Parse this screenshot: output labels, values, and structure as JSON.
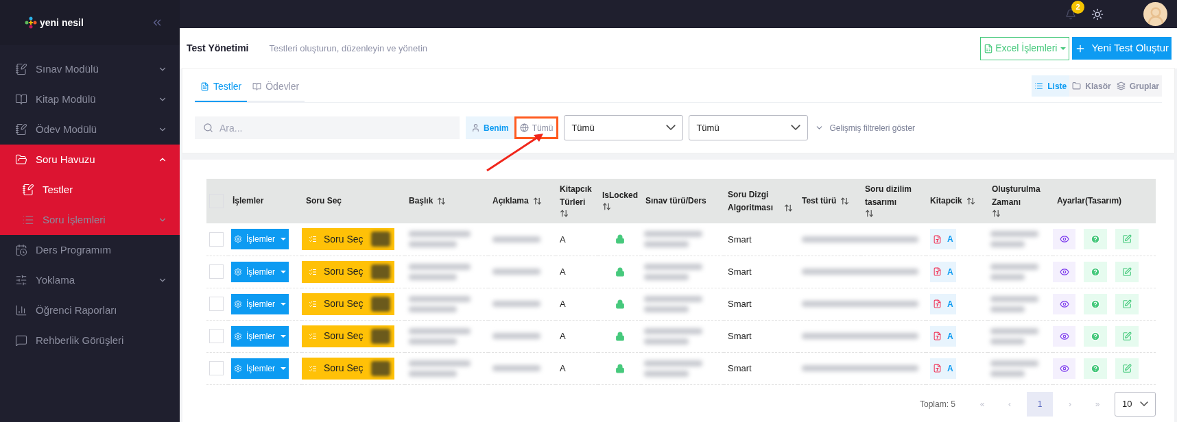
{
  "sidebar": {
    "logo": "yeni nesil",
    "items": [
      {
        "label": "Sınav Modülü",
        "expanded": false,
        "selected": false
      },
      {
        "label": "Kitap Modülü",
        "expanded": false,
        "selected": false
      },
      {
        "label": "Ödev Modülü",
        "expanded": false,
        "selected": false
      },
      {
        "label": "Soru Havuzu",
        "expanded": true,
        "selected": true,
        "children": [
          {
            "label": "Testler",
            "selected": true
          },
          {
            "label": "Soru İşlemleri",
            "expanded": false,
            "selected": false
          }
        ]
      },
      {
        "label": "Ders Programım",
        "selected": false
      },
      {
        "label": "Yoklama",
        "expanded": false,
        "selected": false
      },
      {
        "label": "Öğrenci Raporları",
        "selected": false
      },
      {
        "label": "Rehberlik Görüşleri",
        "selected": false
      }
    ]
  },
  "topbar": {
    "notification_count": "2"
  },
  "header": {
    "title": "Test Yönetimi",
    "subtitle": "Testleri oluşturun, düzenleyin ve yönetin",
    "excel_button": "Excel İşlemleri",
    "create_button": "Yeni Test Oluştur"
  },
  "tabs": [
    {
      "label": "Testler",
      "selected": true
    },
    {
      "label": "Ödevler",
      "selected": false
    }
  ],
  "view_modes": [
    {
      "label": "Liste",
      "selected": true
    },
    {
      "label": "Klasör",
      "selected": false
    },
    {
      "label": "Gruplar",
      "selected": false
    }
  ],
  "filters": {
    "search_placeholder": "Ara...",
    "scope": [
      {
        "label": "Benim",
        "selected": true,
        "highlighted": false
      },
      {
        "label": "Tümü",
        "selected": false,
        "highlighted": true
      }
    ],
    "selects": [
      "Tümü",
      "Tümü"
    ],
    "advanced_link": "Gelişmiş filtreleri göster"
  },
  "table": {
    "all_checked": false,
    "columns": [
      {
        "label": "İşlemler",
        "sortable": false
      },
      {
        "label": "Soru Seç",
        "sortable": false
      },
      {
        "label": "Başlık",
        "sortable": true
      },
      {
        "label": "Açıklama",
        "sortable": true
      },
      {
        "label": "Kitapcık Türleri",
        "sortable": true
      },
      {
        "label": "IsLocked",
        "sortable": true
      },
      {
        "label": "Sınav türü/Ders",
        "sortable": false
      },
      {
        "label": "Soru Dizgi Algoritması",
        "sortable": true
      },
      {
        "label": "Test türü",
        "sortable": true
      },
      {
        "label": "Soru dizilim tasarımı",
        "sortable": true
      },
      {
        "label": "Kitapcik",
        "sortable": true
      },
      {
        "label": "Oluşturulma Zamanı",
        "sortable": true
      },
      {
        "label": "Ayarlar(Tasarım)",
        "sortable": false
      }
    ],
    "rows": [
      {
        "checked": false,
        "actions": "İşlemler",
        "select": "Soru Seç",
        "booklet_types": "A",
        "locked": true,
        "algorithm": "Smart",
        "booklet": "A"
      },
      {
        "checked": false,
        "actions": "İşlemler",
        "select": "Soru Seç",
        "booklet_types": "A",
        "locked": true,
        "algorithm": "Smart",
        "booklet": "A"
      },
      {
        "checked": false,
        "actions": "İşlemler",
        "select": "Soru Seç",
        "booklet_types": "A",
        "locked": true,
        "algorithm": "Smart",
        "booklet": "A"
      },
      {
        "checked": false,
        "actions": "İşlemler",
        "select": "Soru Seç",
        "booklet_types": "A",
        "locked": true,
        "algorithm": "Smart",
        "booklet": "A"
      },
      {
        "checked": false,
        "actions": "İşlemler",
        "select": "Soru Seç",
        "booklet_types": "A",
        "locked": true,
        "algorithm": "Smart",
        "booklet": "A"
      }
    ]
  },
  "pagination": {
    "total": "Toplam: 5",
    "first": "«",
    "prev": "‹",
    "pages": [
      {
        "label": "1",
        "selected": true
      }
    ],
    "next": "›",
    "last": "»",
    "page_size": "10"
  }
}
